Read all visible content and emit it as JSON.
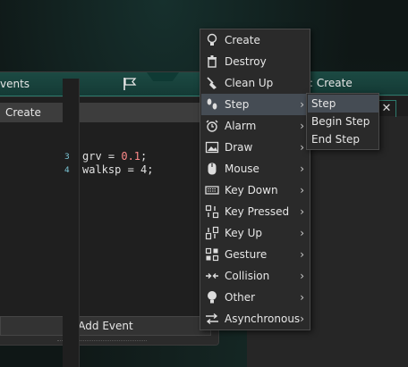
{
  "events_panel": {
    "title": "vents",
    "rows": [
      "Create"
    ],
    "add_event_label": "Add Event"
  },
  "code_panel": {
    "title": ": Create",
    "close_glyph": "✕",
    "lines": [
      {
        "num": "3",
        "prefix": "grv = ",
        "value": "0.1",
        "suffix": ";"
      },
      {
        "num": "4",
        "prefix": "walksp = 4;",
        "value": "",
        "suffix": ""
      }
    ]
  },
  "context_menu": {
    "items": [
      {
        "label": "Create",
        "icon": "lightbulb-icon",
        "submenu": false
      },
      {
        "label": "Destroy",
        "icon": "trash-icon",
        "submenu": false
      },
      {
        "label": "Clean Up",
        "icon": "broom-icon",
        "submenu": false
      },
      {
        "label": "Step",
        "icon": "footsteps-icon",
        "submenu": true,
        "active": true
      },
      {
        "label": "Alarm",
        "icon": "alarm-clock-icon",
        "submenu": true
      },
      {
        "label": "Draw",
        "icon": "picture-icon",
        "submenu": true
      },
      {
        "label": "Mouse",
        "icon": "mouse-icon",
        "submenu": true
      },
      {
        "label": "Key Down",
        "icon": "keyboard-icon",
        "submenu": true
      },
      {
        "label": "Key Pressed",
        "icon": "key-pressed-icon",
        "submenu": true
      },
      {
        "label": "Key Up",
        "icon": "key-up-icon",
        "submenu": true
      },
      {
        "label": "Gesture",
        "icon": "gesture-icon",
        "submenu": true
      },
      {
        "label": "Collision",
        "icon": "collision-icon",
        "submenu": true
      },
      {
        "label": "Other",
        "icon": "bulb-icon",
        "submenu": true
      },
      {
        "label": "Asynchronous",
        "icon": "async-arrows-icon",
        "submenu": true
      }
    ]
  },
  "step_submenu": {
    "items": [
      "Step",
      "Begin Step",
      "End Step"
    ]
  },
  "colors": {
    "header_teal": "#1c4a43",
    "menu_bg": "#2a2a2a",
    "menu_active": "#454c54",
    "code_number": "#ff8a8a"
  }
}
